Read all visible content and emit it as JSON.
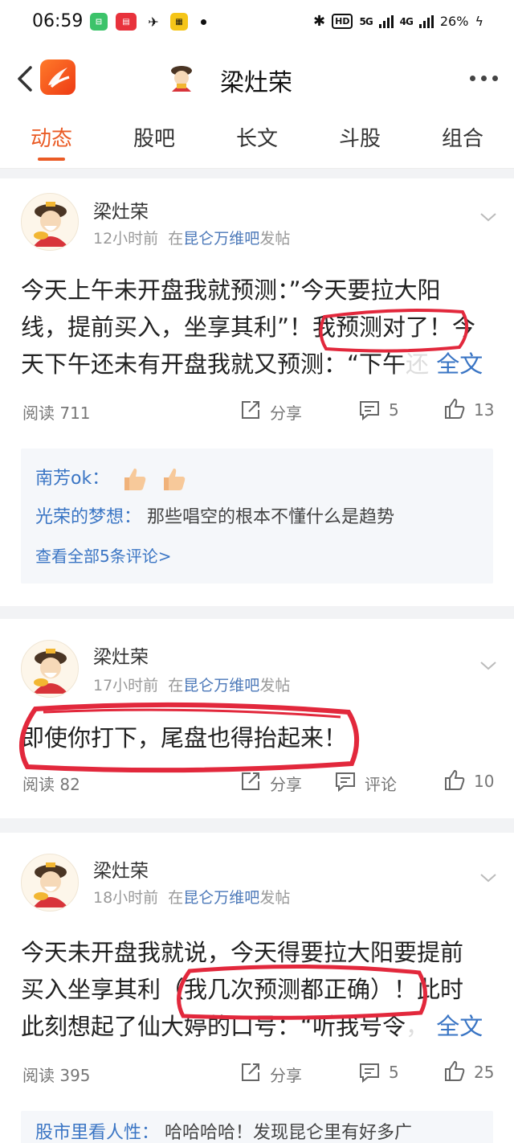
{
  "status_bar": {
    "time": "06:59",
    "battery": "26%",
    "network": "4G",
    "network_5g": "5G",
    "hd": "HD"
  },
  "header": {
    "title": "梁灶荣"
  },
  "tabs": [
    "动态",
    "股吧",
    "长文",
    "斗股",
    "组合"
  ],
  "colors": {
    "accent": "#ea5b25",
    "link": "#3a75c4",
    "annotation": "#e2283c"
  },
  "posts": [
    {
      "author": "梁灶荣",
      "time": "12小时前",
      "in": "在",
      "forum": "昆仑万维吧",
      "action": "发帖",
      "lines": [
        "今天上午未开盘我就预测：”今天要拉大阳",
        "线，提前买入，坐享其利”！我预测对了！今",
        "天下午还未有开盘我就又预测：“下午"
      ],
      "fade": "还",
      "read_more": "全文",
      "reads": "阅读 711",
      "share": "分享",
      "comments_count": "5",
      "likes": "13",
      "comments": [
        {
          "user": "南芳ok：",
          "text": ""
        },
        {
          "user": "光荣的梦想：",
          "text": "那些唱空的根本不懂什么是趋势"
        }
      ],
      "view_all": "查看全部5条评论>"
    },
    {
      "author": "梁灶荣",
      "time": "17小时前",
      "in": "在",
      "forum": "昆仑万维吧",
      "action": "发帖",
      "lines": [
        "即使你打下，尾盘也得抬起来！"
      ],
      "reads": "阅读 82",
      "share": "分享",
      "comment_label": "评论",
      "likes": "10"
    },
    {
      "author": "梁灶荣",
      "time": "18小时前",
      "in": "在",
      "forum": "昆仑万维吧",
      "action": "发帖",
      "lines": [
        "今天未开盘我就说，今天得要拉大阳要提前",
        "买入坐享其利（我几次预测都正确）！此时",
        "此刻想起了仙大婷的口号：“听我号令"
      ],
      "fade": "，",
      "read_more": "全文",
      "reads": "阅读 395",
      "share": "分享",
      "comments_count": "5",
      "likes": "25",
      "comments": [
        {
          "user": "股市里看人性：",
          "text": "哈哈哈哈！发现昆仑里有好多广"
        }
      ]
    }
  ]
}
